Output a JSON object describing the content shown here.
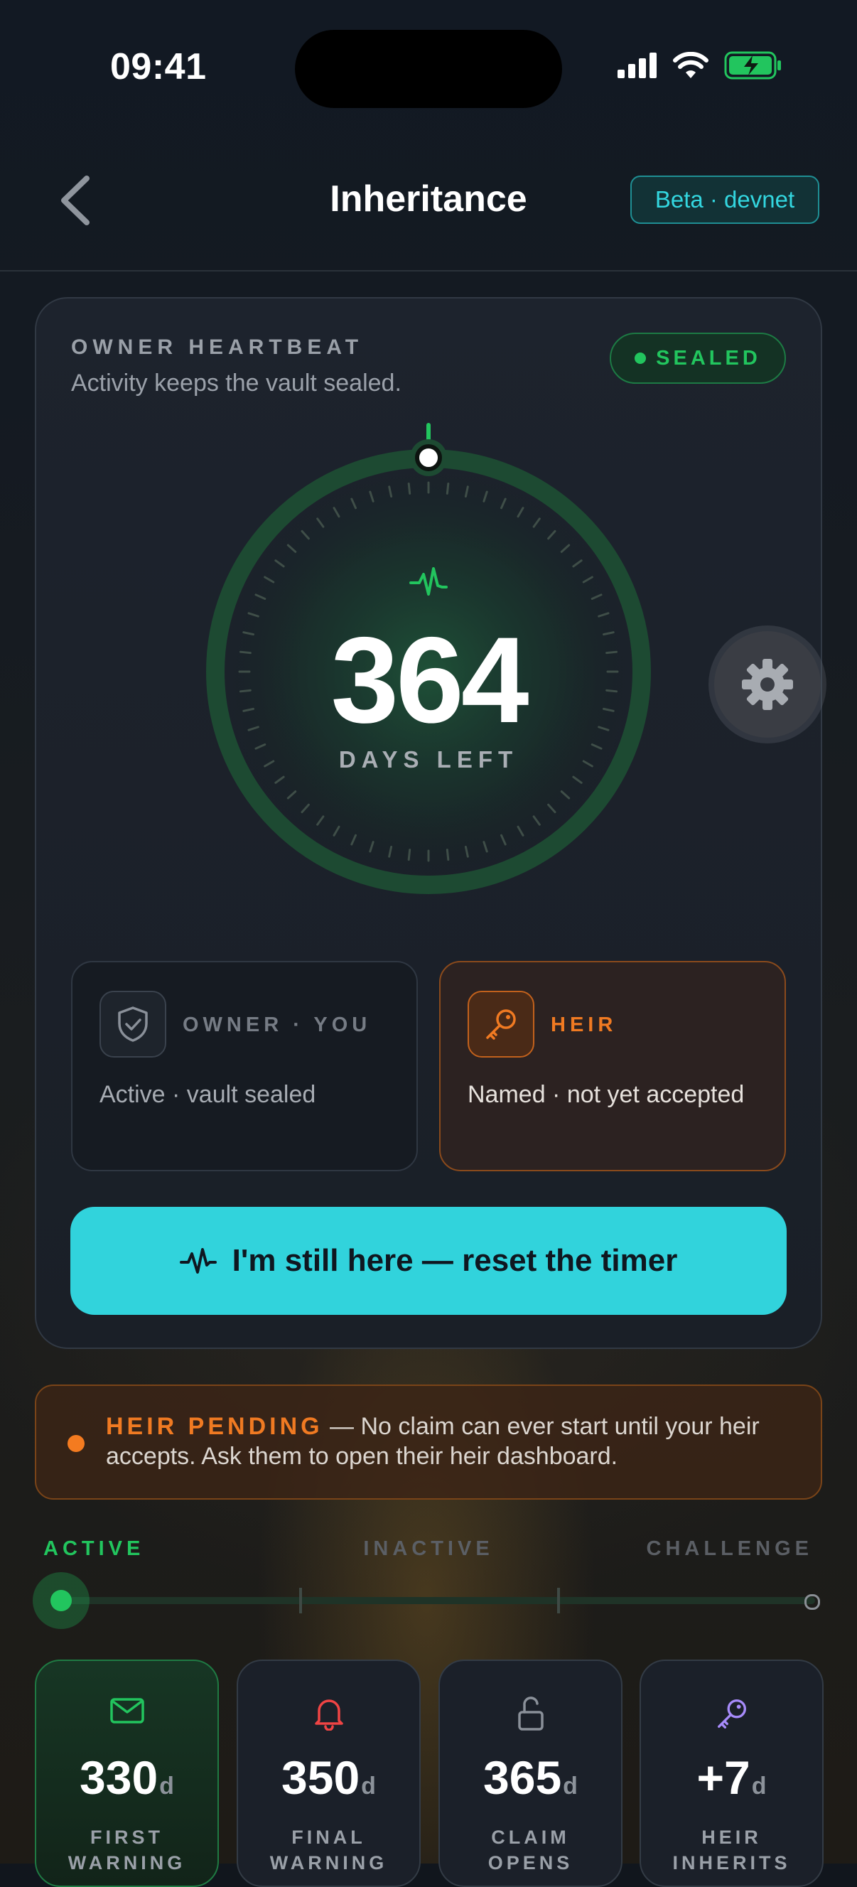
{
  "status_bar": {
    "time": "09:41"
  },
  "header": {
    "title": "Inheritance",
    "badge": "Beta · devnet"
  },
  "heartbeat": {
    "label": "OWNER HEARTBEAT",
    "subtitle": "Activity keeps the vault sealed.",
    "status": "SEALED",
    "days_left": "364",
    "days_label": "DAYS LEFT"
  },
  "roles": {
    "owner": {
      "label": "OWNER · YOU",
      "status": "Active · vault sealed"
    },
    "heir": {
      "label": "HEIR",
      "status": "Named · not yet accepted"
    }
  },
  "reset_button": {
    "label": "I'm still here — reset the timer"
  },
  "pending": {
    "highlight": "HEIR PENDING",
    "separator": " — ",
    "message": "No claim can ever start until your heir accepts. Ask them to open their heir dashboard."
  },
  "phases": [
    "ACTIVE",
    "INACTIVE",
    "CHALLENGE"
  ],
  "milestones": [
    {
      "value": "330",
      "unit": "d",
      "caption_1": "FIRST",
      "caption_2": "WARNING",
      "icon": "mail-icon"
    },
    {
      "value": "350",
      "unit": "d",
      "caption_1": "FINAL",
      "caption_2": "WARNING",
      "icon": "bell-icon"
    },
    {
      "value": "365",
      "unit": "d",
      "caption_1": "CLAIM",
      "caption_2": "OPENS",
      "icon": "unlock-icon"
    },
    {
      "value": "+7",
      "unit": "d",
      "caption_1": "HEIR",
      "caption_2": "INHERITS",
      "icon": "key-icon"
    }
  ],
  "colors": {
    "accent_cyan": "#31d3dc",
    "sealed_green": "#22c55e",
    "heir_orange": "#f07a22"
  }
}
